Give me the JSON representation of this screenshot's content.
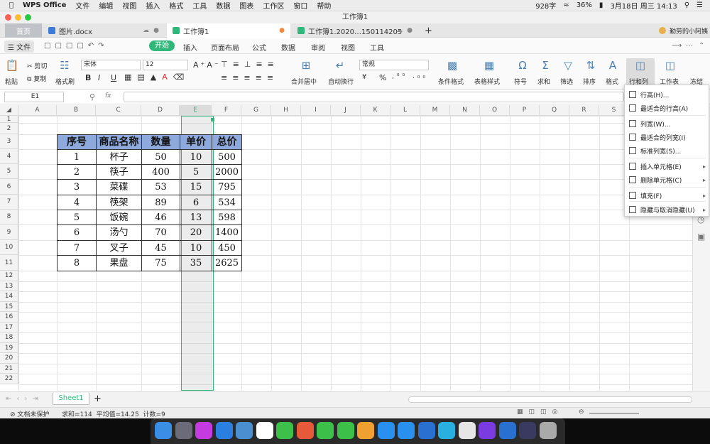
{
  "mac": {
    "app": "WPS Office",
    "menus": [
      "文件",
      "编辑",
      "视图",
      "插入",
      "格式",
      "工具",
      "数据",
      "图表",
      "工作区",
      "窗口",
      "帮助"
    ],
    "wordcount": "928字",
    "battery": "36%",
    "datetime": "3月18日 周三  14:13"
  },
  "window_title": "工作簿1",
  "tabs": [
    {
      "label": "首页"
    },
    {
      "label": "图片.docx"
    },
    {
      "label": "工作簿1"
    },
    {
      "label": "工作簿1.2020…150114205"
    }
  ],
  "user": "勤劳的小阿姨",
  "menu": {
    "file": "文件",
    "start": "开始",
    "items": [
      "插入",
      "页面布局",
      "公式",
      "数据",
      "审阅",
      "视图",
      "工具"
    ]
  },
  "ribbon": {
    "paste": "粘贴",
    "cut": "剪切",
    "copy": "复制",
    "format_painter": "格式刷",
    "font": "宋体",
    "size": "12",
    "bold": "B",
    "italic": "I",
    "underline": "U",
    "merge": "合并居中",
    "wrap": "自动换行",
    "numfmt": "常规",
    "percent": "%",
    "cond_format": "条件格式",
    "table_style": "表格样式",
    "symbol": "符号",
    "sum": "求和",
    "filter": "筛选",
    "sort": "排序",
    "format": "格式",
    "rowcol": "行和列",
    "worksheet": "工作表",
    "freeze": "冻结"
  },
  "formula": {
    "namebox": "E1",
    "fx": "fx"
  },
  "columns": [
    "A",
    "B",
    "C",
    "D",
    "E",
    "F",
    "G",
    "H",
    "I",
    "J",
    "K",
    "L",
    "M",
    "N",
    "O",
    "P",
    "Q",
    "R",
    "S"
  ],
  "rows": [
    "1",
    "2",
    "3",
    "4",
    "5",
    "6",
    "7",
    "8",
    "9",
    "10",
    "11",
    "12",
    "13",
    "14",
    "15",
    "16",
    "17",
    "18",
    "19",
    "20",
    "21",
    "22"
  ],
  "table": {
    "headers": [
      "序号",
      "商品名称",
      "数量",
      "单价",
      "总价"
    ],
    "rows": [
      [
        "1",
        "杯子",
        "50",
        "10",
        "500"
      ],
      [
        "2",
        "筷子",
        "400",
        "5",
        "2000"
      ],
      [
        "3",
        "菜碟",
        "53",
        "15",
        "795"
      ],
      [
        "4",
        "筷架",
        "89",
        "6",
        "534"
      ],
      [
        "5",
        "饭碗",
        "46",
        "13",
        "598"
      ],
      [
        "6",
        "汤勺",
        "70",
        "20",
        "1400"
      ],
      [
        "7",
        "叉子",
        "45",
        "10",
        "450"
      ],
      [
        "8",
        "果盘",
        "75",
        "35",
        "2625"
      ]
    ]
  },
  "dropdown": [
    {
      "label": "行高(H)...",
      "icon": "row-height-icon"
    },
    {
      "label": "最适合的行高(A)",
      "icon": "autofit-row-icon"
    },
    {
      "label": "列宽(W)...",
      "icon": "col-width-icon"
    },
    {
      "label": "最适合的列宽(I)",
      "icon": "autofit-col-icon"
    },
    {
      "label": "标准列宽(S)...",
      "icon": "std-width-icon"
    },
    {
      "label": "插入单元格(E)",
      "icon": "insert-cell-icon",
      "sub": true
    },
    {
      "label": "删除单元格(C)",
      "icon": "delete-cell-icon",
      "sub": true
    },
    {
      "label": "填充(F)",
      "icon": "fill-icon",
      "sub": true
    },
    {
      "label": "隐藏与取消隐藏(U)",
      "icon": "hide-icon",
      "sub": true
    }
  ],
  "sheet": {
    "name": "Sheet1",
    "plus": "+"
  },
  "status": {
    "protect": "文档未保护",
    "stats": "求和=114  平均值=14.25  计数=9"
  },
  "colors": {
    "accent": "#2fb87a",
    "header_fill": "#8ea9db"
  }
}
